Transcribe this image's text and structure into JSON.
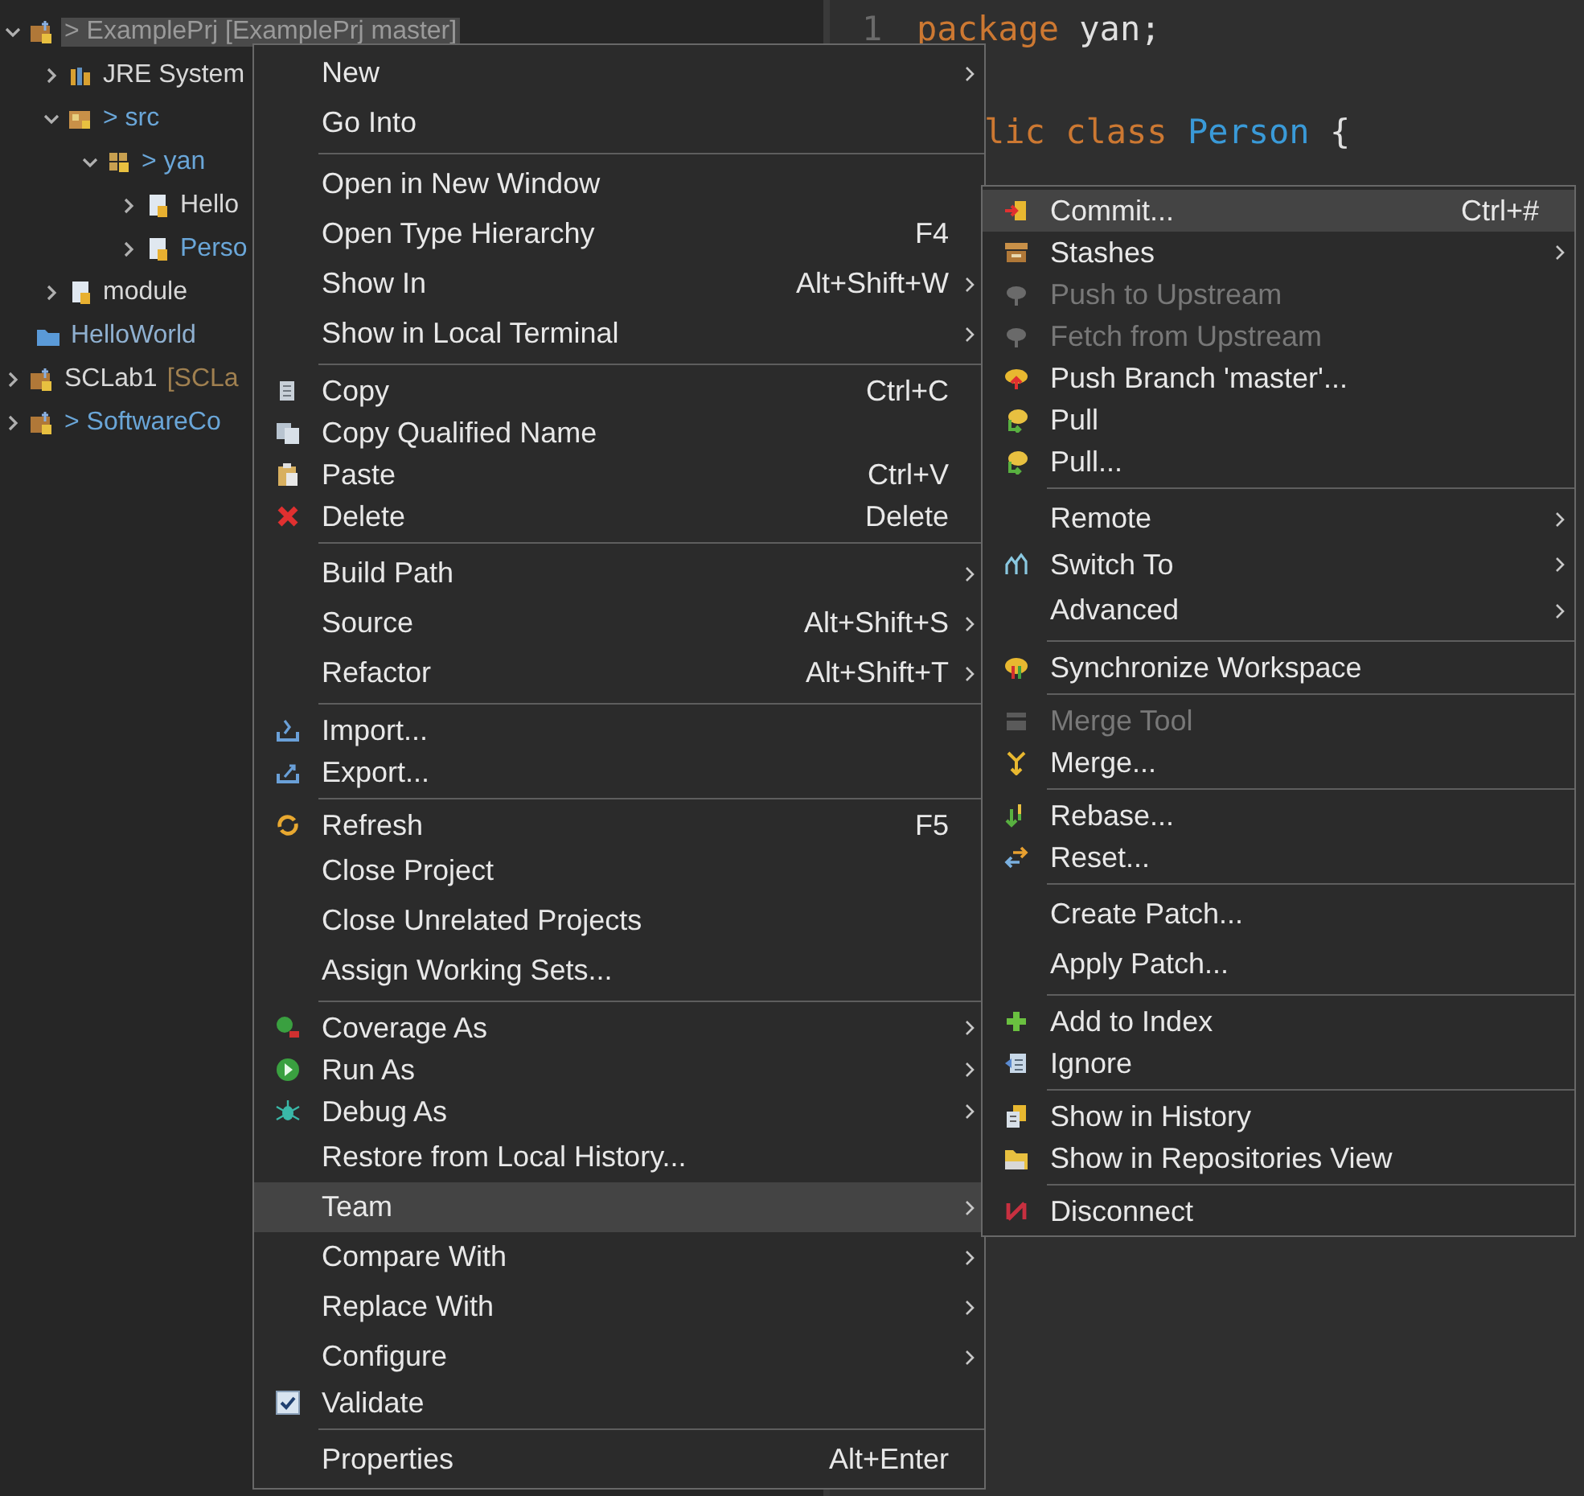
{
  "project_tree": [
    {
      "label": "> ExamplePrj [ExamplePrj master]",
      "selected": true,
      "expanded": true,
      "children": [
        {
          "label": "JRE System",
          "color": "#d8d8d8",
          "selected": false,
          "expanded": false
        },
        {
          "label": "> src",
          "color": "#6aa6d8",
          "selected": false,
          "expanded": true,
          "children": [
            {
              "label": "> yan",
              "color": "#6aa6d8",
              "selected": false,
              "expanded": true,
              "children": [
                {
                  "label": "Hello",
                  "color": "#d8d8d8",
                  "selected": false,
                  "expanded": false
                },
                {
                  "label": "Perso",
                  "color": "#6aa6d8",
                  "selected": false,
                  "expanded": false
                }
              ]
            }
          ]
        },
        {
          "label": "module",
          "color": "#d8d8d8",
          "selected": false,
          "expanded": false
        }
      ]
    },
    {
      "label": "HelloWorld",
      "color": "#8fb0d0",
      "selected": false
    },
    {
      "label": "SCLab1",
      "decoration": "[SCLa",
      "color": "#d8d8d8",
      "selected": false,
      "expanded": false
    },
    {
      "label": "> SoftwareCo",
      "color": "#6aa6d8",
      "selected": false,
      "expanded": false
    }
  ],
  "editor": {
    "lines": [
      {
        "number": "1",
        "tokens": [
          {
            "text": "package",
            "kind": "keyword"
          },
          {
            "text": " yan;",
            "kind": "plain"
          }
        ]
      },
      {
        "tokens": [
          {
            "text": "lic class",
            "kind": "keyword"
          },
          {
            "text": " Person",
            "kind": "type"
          },
          {
            "text": " {",
            "kind": "plain"
          }
        ]
      }
    ]
  },
  "context_menu": {
    "sections": [
      [
        {
          "label": "New",
          "submenu": true,
          "selected": false,
          "disabled": false
        },
        {
          "label": "Go Into",
          "submenu": false,
          "selected": false,
          "disabled": false
        }
      ],
      [
        {
          "label": "Open in New Window",
          "submenu": false,
          "selected": false,
          "disabled": false
        },
        {
          "label": "Open Type Hierarchy",
          "shortcut": "F4",
          "submenu": false,
          "selected": false,
          "disabled": false
        },
        {
          "label": "Show In",
          "shortcut": "Alt+Shift+W",
          "submenu": true,
          "selected": false,
          "disabled": false
        },
        {
          "label": "Show in Local Terminal",
          "submenu": true,
          "selected": false,
          "disabled": false
        }
      ],
      [
        {
          "label": "Copy",
          "shortcut": "Ctrl+C",
          "submenu": false,
          "selected": false,
          "disabled": false
        },
        {
          "label": "Copy Qualified Name",
          "submenu": false,
          "selected": false,
          "disabled": false
        },
        {
          "label": "Paste",
          "shortcut": "Ctrl+V",
          "submenu": false,
          "selected": false,
          "disabled": false
        },
        {
          "label": "Delete",
          "shortcut": "Delete",
          "submenu": false,
          "selected": false,
          "disabled": false
        }
      ],
      [
        {
          "label": "Build Path",
          "submenu": true,
          "selected": false,
          "disabled": false
        },
        {
          "label": "Source",
          "shortcut": "Alt+Shift+S",
          "submenu": true,
          "selected": false,
          "disabled": false
        },
        {
          "label": "Refactor",
          "shortcut": "Alt+Shift+T",
          "submenu": true,
          "selected": false,
          "disabled": false
        }
      ],
      [
        {
          "label": "Import...",
          "submenu": false,
          "selected": false,
          "disabled": false
        },
        {
          "label": "Export...",
          "submenu": false,
          "selected": false,
          "disabled": false
        }
      ],
      [
        {
          "label": "Refresh",
          "shortcut": "F5",
          "submenu": false,
          "selected": false,
          "disabled": false
        },
        {
          "label": "Close Project",
          "submenu": false,
          "selected": false,
          "disabled": false
        },
        {
          "label": "Close Unrelated Projects",
          "submenu": false,
          "selected": false,
          "disabled": false
        },
        {
          "label": "Assign Working Sets...",
          "submenu": false,
          "selected": false,
          "disabled": false
        }
      ],
      [
        {
          "label": "Coverage As",
          "submenu": true,
          "selected": false,
          "disabled": false
        },
        {
          "label": "Run As",
          "submenu": true,
          "selected": false,
          "disabled": false
        },
        {
          "label": "Debug As",
          "submenu": true,
          "selected": false,
          "disabled": false
        },
        {
          "label": "Restore from Local History...",
          "submenu": false,
          "selected": false,
          "disabled": false
        },
        {
          "label": "Team",
          "submenu": true,
          "selected": true,
          "disabled": false
        },
        {
          "label": "Compare With",
          "submenu": true,
          "selected": false,
          "disabled": false
        },
        {
          "label": "Replace With",
          "submenu": true,
          "selected": false,
          "disabled": false
        },
        {
          "label": "Configure",
          "submenu": true,
          "selected": false,
          "disabled": false
        },
        {
          "label": "Validate",
          "kind": "check",
          "checked": true,
          "submenu": false,
          "selected": false,
          "disabled": false
        }
      ],
      [
        {
          "label": "Properties",
          "shortcut": "Alt+Enter",
          "submenu": false,
          "selected": false,
          "disabled": false
        }
      ]
    ]
  },
  "team_submenu": {
    "sections": [
      [
        {
          "label": "Commit...",
          "shortcut": "Ctrl+#",
          "submenu": false,
          "selected": true,
          "disabled": false
        },
        {
          "label": "Stashes",
          "submenu": true,
          "selected": false,
          "disabled": false
        },
        {
          "label": "Push to Upstream",
          "submenu": false,
          "selected": false,
          "disabled": true
        },
        {
          "label": "Fetch from Upstream",
          "submenu": false,
          "selected": false,
          "disabled": true
        },
        {
          "label": "Push Branch 'master'...",
          "submenu": false,
          "selected": false,
          "disabled": false
        },
        {
          "label": "Pull",
          "submenu": false,
          "selected": false,
          "disabled": false
        },
        {
          "label": "Pull...",
          "submenu": false,
          "selected": false,
          "disabled": false
        }
      ],
      [
        {
          "label": "Remote",
          "submenu": true,
          "selected": false,
          "disabled": false
        },
        {
          "label": "Switch To",
          "submenu": true,
          "selected": false,
          "disabled": false
        },
        {
          "label": "Advanced",
          "submenu": true,
          "selected": false,
          "disabled": false
        }
      ],
      [
        {
          "label": "Synchronize Workspace",
          "submenu": false,
          "selected": false,
          "disabled": false
        }
      ],
      [
        {
          "label": "Merge Tool",
          "submenu": false,
          "selected": false,
          "disabled": true
        },
        {
          "label": "Merge...",
          "submenu": false,
          "selected": false,
          "disabled": false
        }
      ],
      [
        {
          "label": "Rebase...",
          "submenu": false,
          "selected": false,
          "disabled": false
        },
        {
          "label": "Reset...",
          "submenu": false,
          "selected": false,
          "disabled": false
        }
      ],
      [
        {
          "label": "Create Patch...",
          "submenu": false,
          "selected": false,
          "disabled": false
        },
        {
          "label": "Apply Patch...",
          "submenu": false,
          "selected": false,
          "disabled": false
        }
      ],
      [
        {
          "label": "Add to Index",
          "submenu": false,
          "selected": false,
          "disabled": false
        },
        {
          "label": "Ignore",
          "submenu": false,
          "selected": false,
          "disabled": false
        }
      ],
      [
        {
          "label": "Show in History",
          "submenu": false,
          "selected": false,
          "disabled": false
        },
        {
          "label": "Show in Repositories View",
          "submenu": false,
          "selected": false,
          "disabled": false
        }
      ],
      [
        {
          "label": "Disconnect",
          "submenu": false,
          "selected": false,
          "disabled": false
        }
      ]
    ]
  }
}
